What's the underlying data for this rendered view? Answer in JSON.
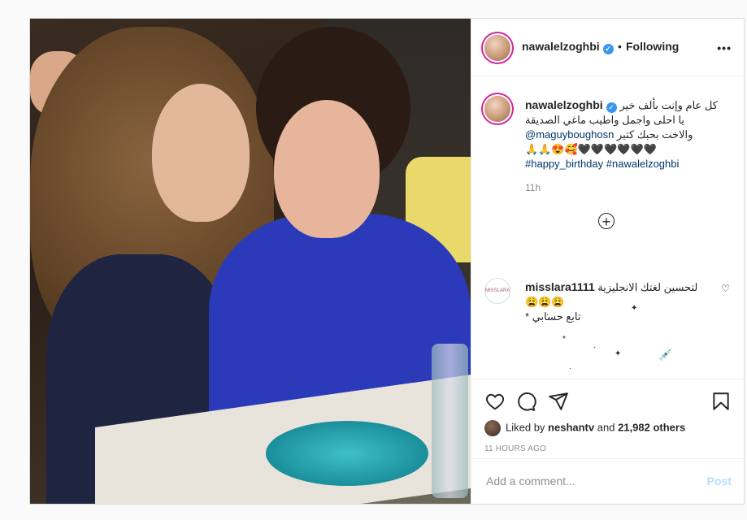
{
  "post": {
    "username": "nawalelzoghbi",
    "follow_separator": "•",
    "follow_status": "Following",
    "more_label": "•••"
  },
  "caption": {
    "username": "nawalelzoghbi",
    "line1": "كل عام وإنت بألف خير",
    "line2": "يا احلى واجمل واطيب ماغي الصديقة",
    "line3_mention": "@maguyboughosn",
    "line3_text": "والاخت بحبك كتير",
    "line4": "🙏🙏😍🥰🖤🖤🖤🖤🖤🖤",
    "hashtag1": "#happy_birthday",
    "hashtag2": "#nawalelzoghbi",
    "time": "11h"
  },
  "load_more_label": "+",
  "comment": {
    "username": "misslara1111",
    "avatar_text": "MISSLARA",
    "text": "لتحسين لغتك الانجليزية 😩😩😩",
    "text2": "تابع حسابي",
    "asterisk": "*",
    "decorations": [
      "✦",
      ".",
      "*",
      ".",
      "✦",
      "💉",
      ".",
      ".",
      "."
    ]
  },
  "actions": {
    "liked_by_prefix": "Liked by",
    "liked_by_user": "neshantv",
    "liked_by_and": "and",
    "liked_count": "21,982 others",
    "timestamp": "11 HOURS AGO"
  },
  "add_comment": {
    "placeholder": "Add a comment...",
    "post_label": "Post"
  }
}
